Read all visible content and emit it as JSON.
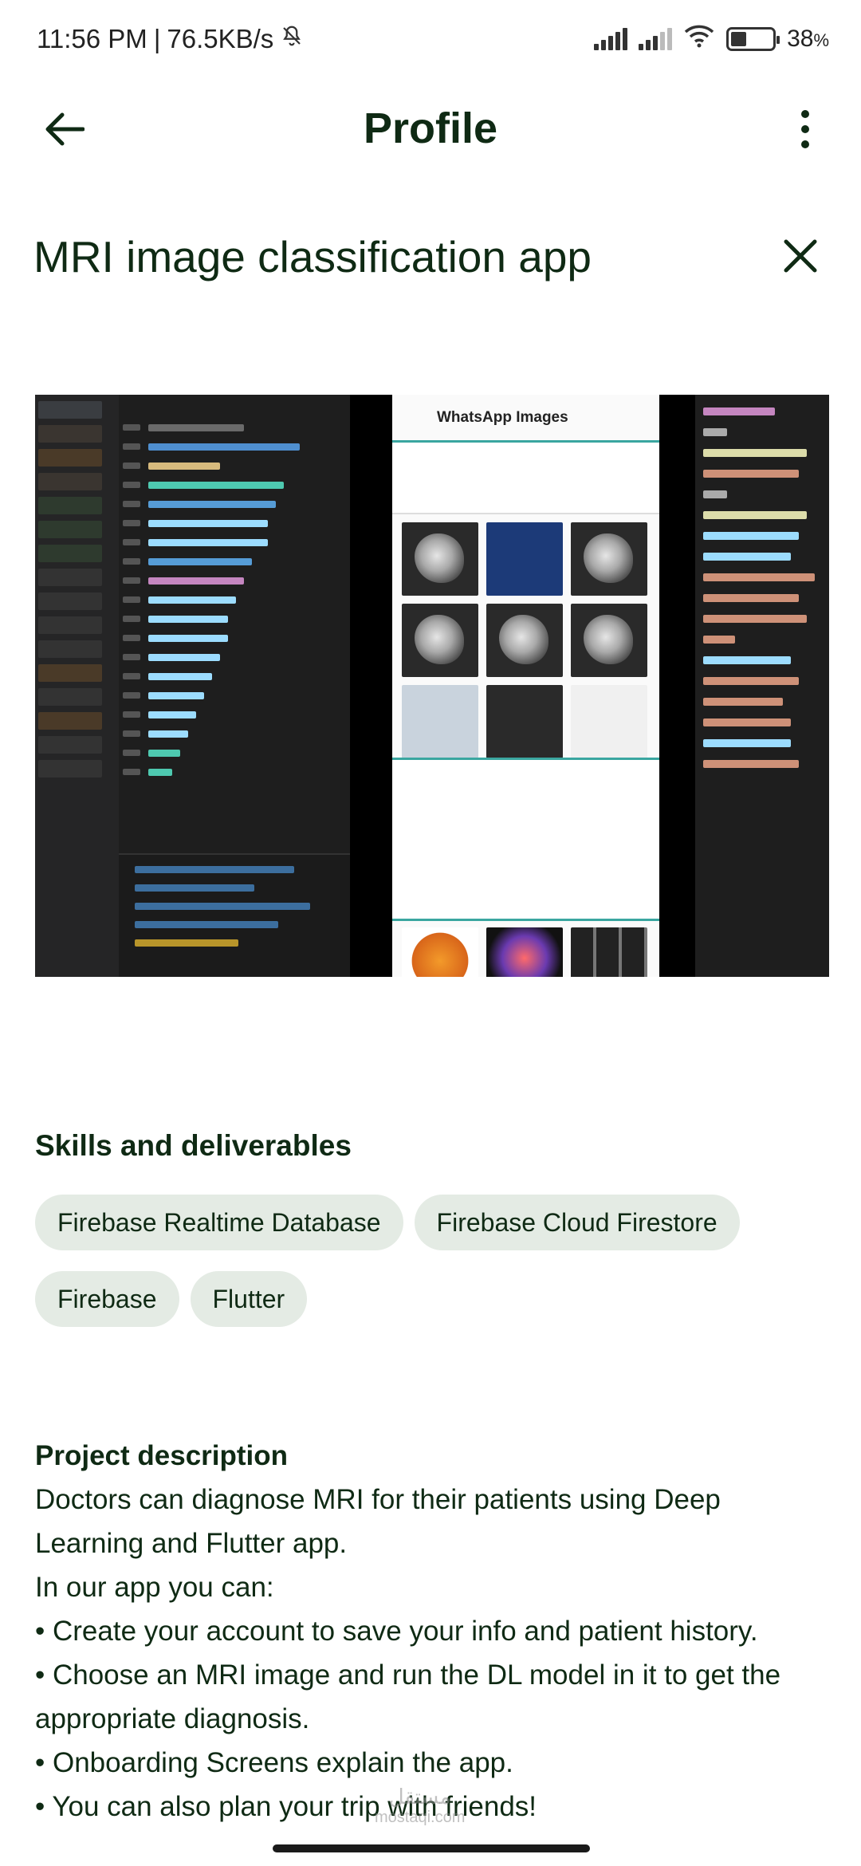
{
  "status_bar": {
    "time": "11:56 PM",
    "separator": "|",
    "network_speed": "76.5KB/s",
    "battery_level": "38",
    "battery_unit": "%",
    "battery_fraction": 0.38
  },
  "app_bar": {
    "title": "Profile"
  },
  "project": {
    "title": "MRI image classification app"
  },
  "media": {
    "phone_screen_title": "WhatsApp Images"
  },
  "skills": {
    "heading": "Skills and deliverables",
    "items": [
      "Firebase Realtime Database",
      "Firebase Cloud Firestore",
      "Firebase",
      "Flutter"
    ]
  },
  "description": {
    "heading": "Project description",
    "lines": [
      "Doctors can diagnose MRI for their patients using Deep Learning and Flutter app.",
      "In our app you can:",
      "• Create your account to save your info and patient history.",
      "• Choose an MRI image and run the DL model in it to get the appropriate diagnosis.",
      "• Onboarding Screens explain the app.",
      "• You can also plan your trip with friends!"
    ]
  },
  "watermark": {
    "arabic": "مستقل",
    "latin": "mostaqi.com"
  },
  "colors": {
    "primary_text": "#0f2a14",
    "chip_background": "#e4ebe4"
  }
}
